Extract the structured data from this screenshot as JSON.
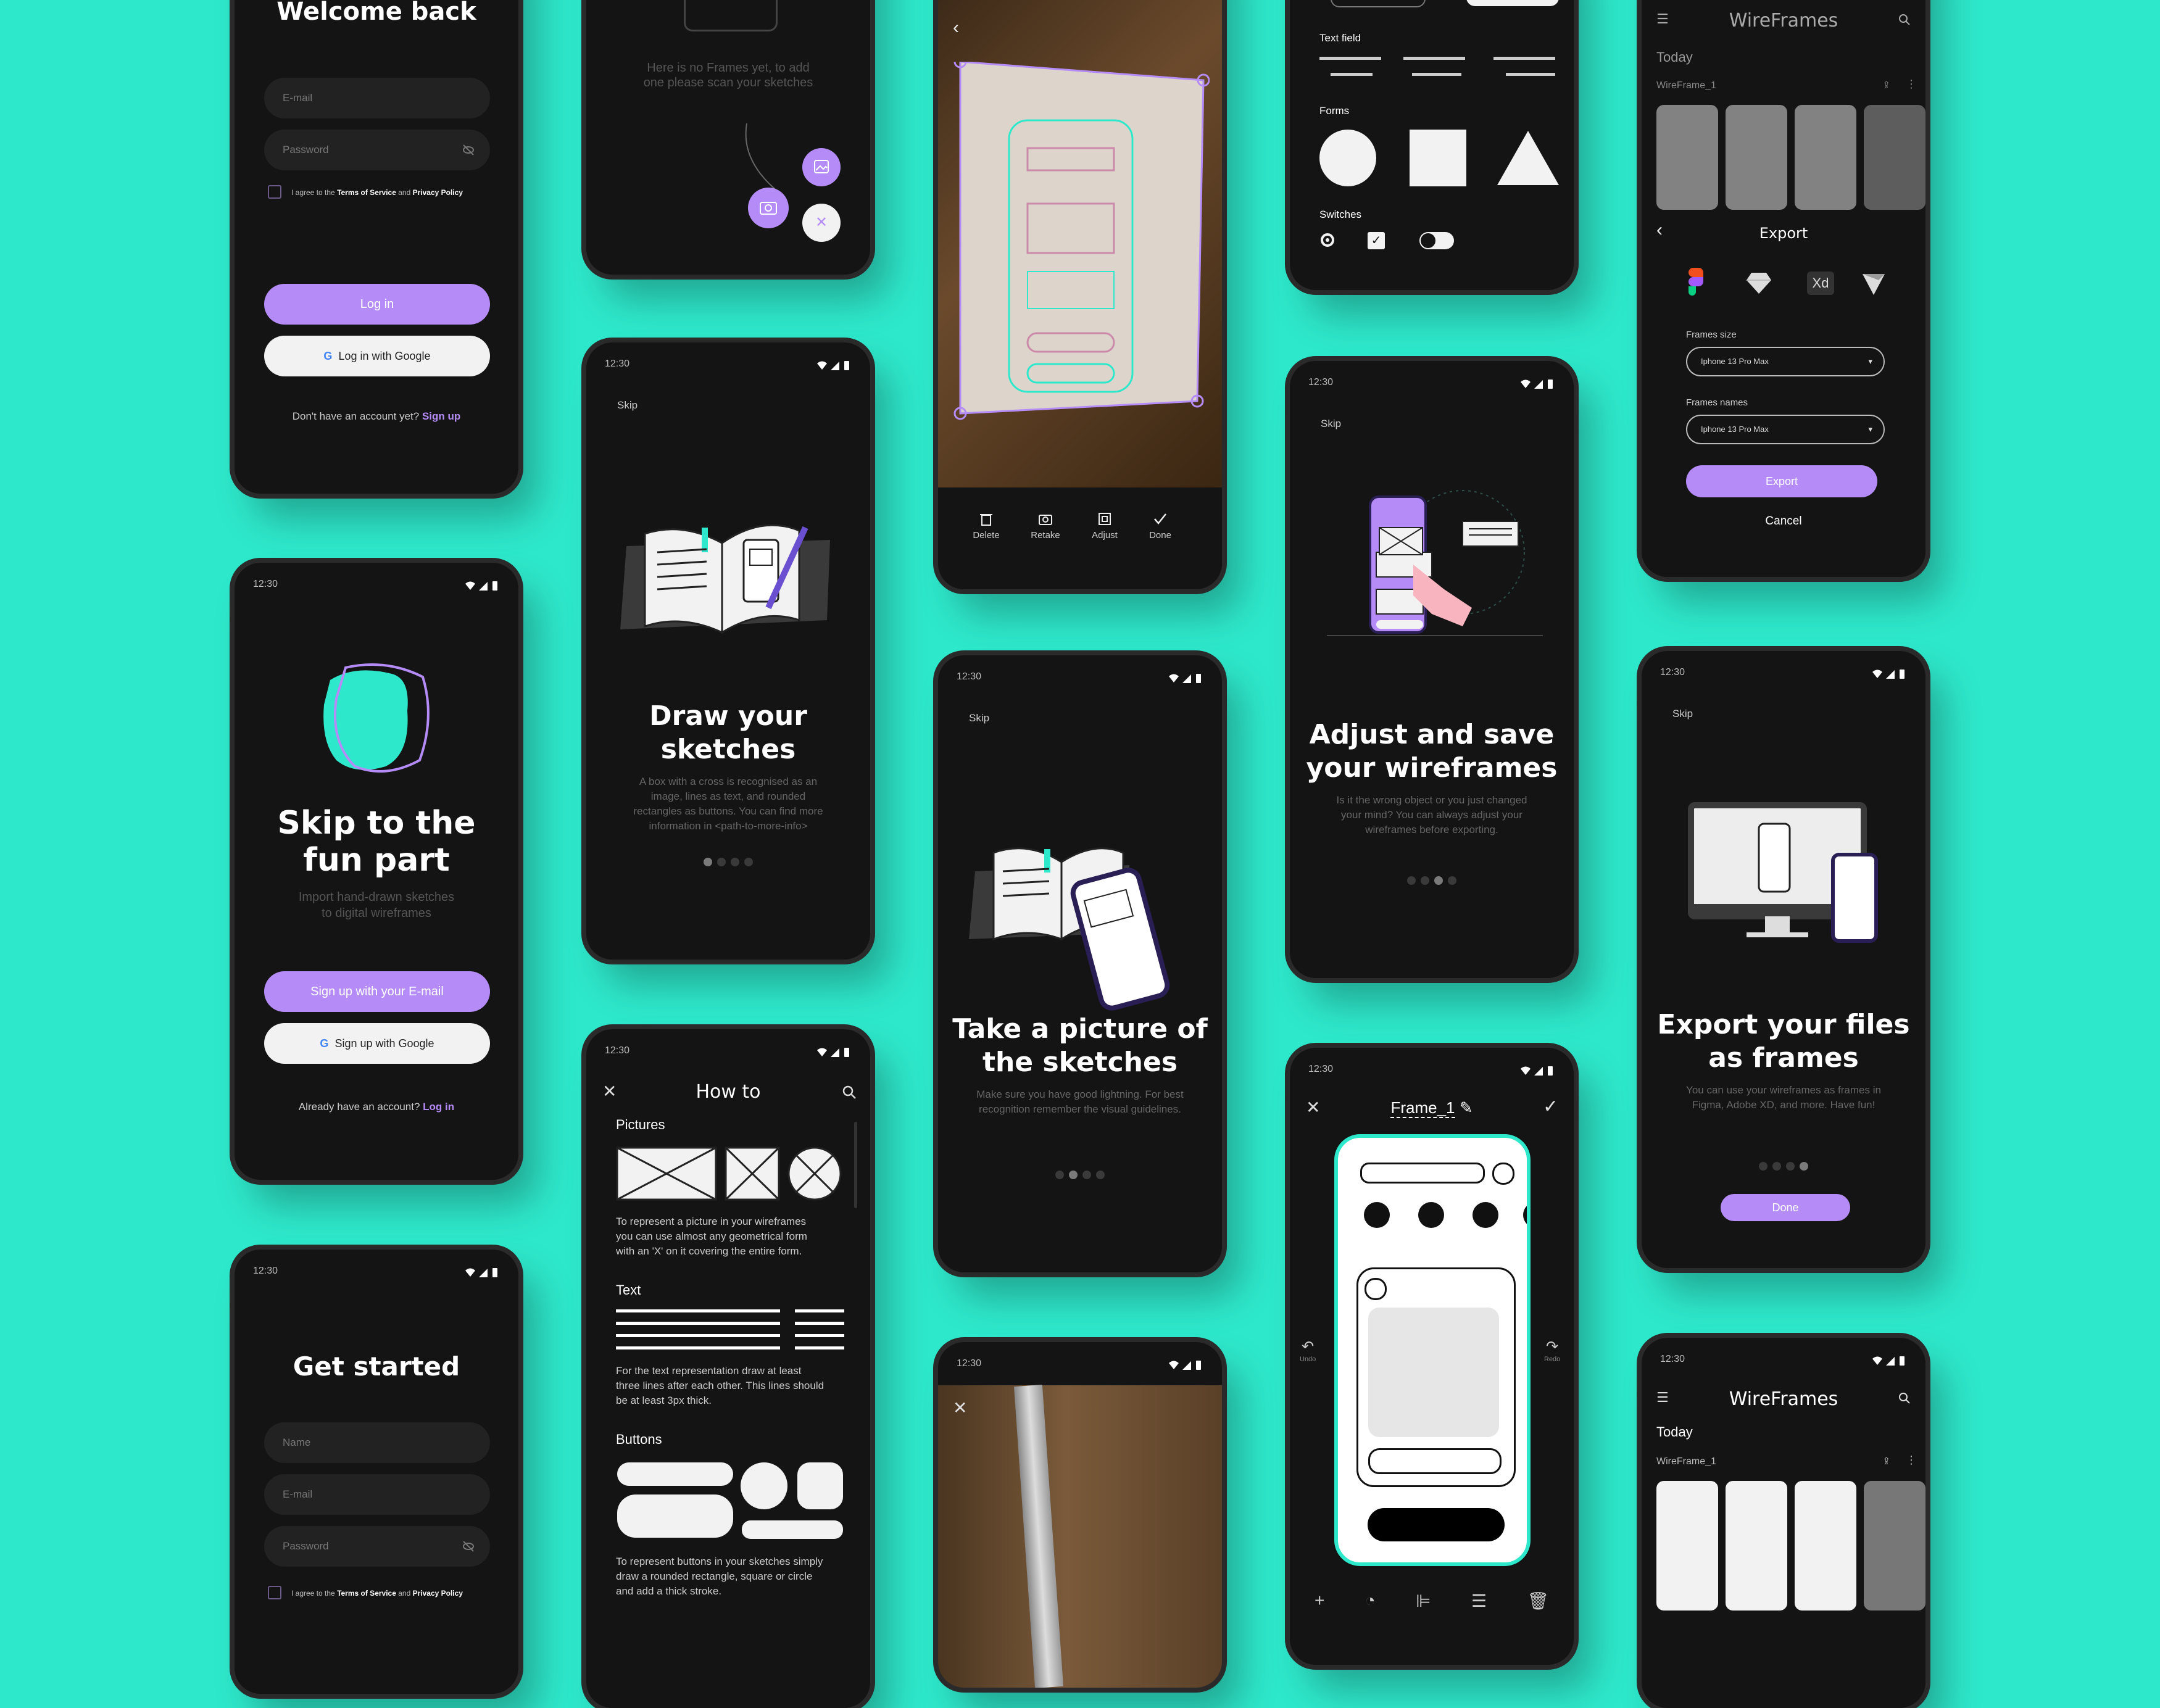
{
  "colors": {
    "background": "#2ee8cb",
    "accent": "#b58cf7",
    "teal": "#2ee8cb",
    "phone": "#141414"
  },
  "status_time": "12:30",
  "login": {
    "title": "Welcome back",
    "email_placeholder": "E-mail",
    "password_placeholder": "Password",
    "terms_prefix": "I agree to the ",
    "terms_tos": "Terms of Service",
    "terms_and": " and ",
    "terms_privacy": "Privacy Policy",
    "login_button": "Log in",
    "google_button": "Log in with Google",
    "no_account": "Don't have an account yet? ",
    "signup_link": "Sign up"
  },
  "empty": {
    "message": "Here is no Frames yet, to add one please scan your sketches",
    "icons": [
      "image-icon",
      "camera-icon",
      "close-icon"
    ]
  },
  "camera_crop": {
    "back_icon": "chevron-left-icon",
    "actions": [
      {
        "label": "Delete",
        "icon": "trash-icon"
      },
      {
        "label": "Retake",
        "icon": "camera-icon"
      },
      {
        "label": "Adjust",
        "icon": "crop-icon"
      },
      {
        "label": "Done",
        "icon": "check-icon"
      }
    ]
  },
  "elements": {
    "text_field_label": "Text field",
    "forms_label": "Forms",
    "switches_label": "Switches"
  },
  "export_panel": {
    "app_title": "WireFrames",
    "today": "Today",
    "item_name": "WireFrame_1",
    "export_title": "Export",
    "export_targets": [
      "figma-icon",
      "sketch-icon",
      "Xd",
      "invision-icon"
    ],
    "frames_size_label": "Frames size",
    "frames_size_value": "Iphone 13 Pro Max",
    "frames_names_label": "Frames names",
    "frames_names_value": "Iphone 13 Pro Max",
    "export_button": "Export",
    "cancel_button": "Cancel"
  },
  "signup": {
    "title_line1": "Skip to the",
    "title_line2": "fun part",
    "subtitle_line1": "Import hand-drawn sketches",
    "subtitle_line2": "to digital wireframes",
    "email_button": "Sign up with your E-mail",
    "google_button": "Sign up with Google",
    "have_account": "Already have an account? ",
    "login_link": "Log in"
  },
  "onboard_draw": {
    "skip": "Skip",
    "title_line1": "Draw your",
    "title_line2": "sketches",
    "body_line1": "A box with a cross is recognised as an",
    "body_line2": "image, lines as text, and rounded",
    "body_line3": "rectangles as buttons. You can find more",
    "body_line4": "information in <path-to-more-info>",
    "active_dot": 0
  },
  "onboard_picture": {
    "skip": "Skip",
    "title_line1": "Take a picture of",
    "title_line2": "the sketches",
    "body_line1": "Make sure you have good lightning. For best",
    "body_line2": "recognition remember the visual guidelines.",
    "active_dot": 1
  },
  "onboard_adjust": {
    "skip": "Skip",
    "title_line1": "Adjust and save",
    "title_line2": "your wireframes",
    "body_line1": "Is it the wrong object or you just changed",
    "body_line2": "your mind? You can always adjust your",
    "body_line3": "wireframes before exporting.",
    "active_dot": 2
  },
  "onboard_export": {
    "skip": "Skip",
    "title_line1": "Export your files",
    "title_line2": "as frames",
    "body_line1": "You can use your wireframes as frames in",
    "body_line2": "Figma, Adobe XD, and more. Have fun!",
    "done_button": "Done",
    "active_dot": 3
  },
  "getstarted": {
    "title": "Get started",
    "name_placeholder": "Name",
    "email_placeholder": "E-mail",
    "password_placeholder": "Password",
    "terms_prefix": "I agree to the ",
    "terms_tos": "Terms of Service",
    "terms_and": " and ",
    "terms_privacy": "Privacy Policy"
  },
  "howto": {
    "title": "How to",
    "pictures_heading": "Pictures",
    "pictures_text_l1": "To represent a picture in your wireframes",
    "pictures_text_l2": "you can use almost any geometrical form",
    "pictures_text_l3": "with an 'X' on it covering the entire form.",
    "text_heading": "Text",
    "text_text_l1": "For the text representation draw at least",
    "text_text_l2": "three lines after each other. This lines should",
    "text_text_l3": "be at least 3px thick.",
    "buttons_heading": "Buttons",
    "buttons_text_l1": "To represent buttons in your sketches simply",
    "buttons_text_l2": "draw a rounded rectangle, square or circle",
    "buttons_text_l3": "and add a thick stroke."
  },
  "editor": {
    "frame_name": "Frame_1",
    "undo": "Undo",
    "redo": "Redo"
  },
  "home": {
    "app_title": "WireFrames",
    "today": "Today",
    "item_name": "WireFrame_1"
  }
}
